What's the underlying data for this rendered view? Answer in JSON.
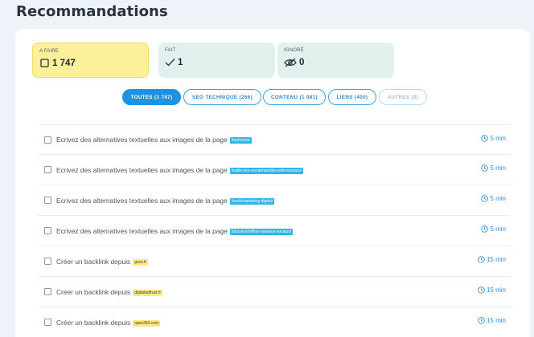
{
  "page": {
    "title": "Recommandations"
  },
  "stats": {
    "todo": {
      "label": "A FAIRE",
      "value": "1 747",
      "icon": "checkbox-icon"
    },
    "done": {
      "label": "FAIT",
      "value": "1",
      "icon": "check-icon"
    },
    "ignored": {
      "label": "IGNORÉ",
      "value": "0",
      "icon": "eye-off-icon"
    }
  },
  "tabs": [
    {
      "label": "TOUTES (1 747)",
      "state": "active"
    },
    {
      "label": "SEO TECHNIQUE (266)",
      "state": "normal"
    },
    {
      "label": "CONTENU (1 081)",
      "state": "normal"
    },
    {
      "label": "LIENS (400)",
      "state": "normal"
    },
    {
      "label": "AUTRES (0)",
      "state": "disabled"
    }
  ],
  "rows": [
    {
      "text": "Ecrivez des alternatives textuelles aux images de la page",
      "tag": "/tools/seo/",
      "tag_type": "url",
      "time": "5 min"
    },
    {
      "text": "Ecrivez des alternatives textuelles aux images de la page",
      "tag": "/outils-seo-recommandes-referenceurs/",
      "tag_type": "url",
      "time": "5 min"
    },
    {
      "text": "Ecrivez des alternatives textuelles aux images de la page",
      "tag": "/tools/marketing-digital/",
      "tag_type": "url",
      "time": "5 min"
    },
    {
      "text": "Ecrivez des alternatives textuelles aux images de la page",
      "tag": "/dossier/chiffres-reseaux-sociaux/",
      "tag_type": "url",
      "time": "5 min"
    },
    {
      "text": "Créer un backlink depuis",
      "tag": "gouv.fr",
      "tag_type": "domain",
      "time": "15 min"
    },
    {
      "text": "Créer un backlink depuis",
      "tag": "digitaladtrust.fr",
      "tag_type": "domain",
      "time": "15 min"
    },
    {
      "text": "Créer un backlink depuis",
      "tag": "opex360.com",
      "tag_type": "domain",
      "time": "15 min"
    }
  ],
  "colors": {
    "accent": "#1c93e0",
    "todo_bg": "#fdf09a",
    "done_bg": "#e2f1ee",
    "url_tag": "#2fb5e8",
    "domain_tag": "#fde97e"
  }
}
